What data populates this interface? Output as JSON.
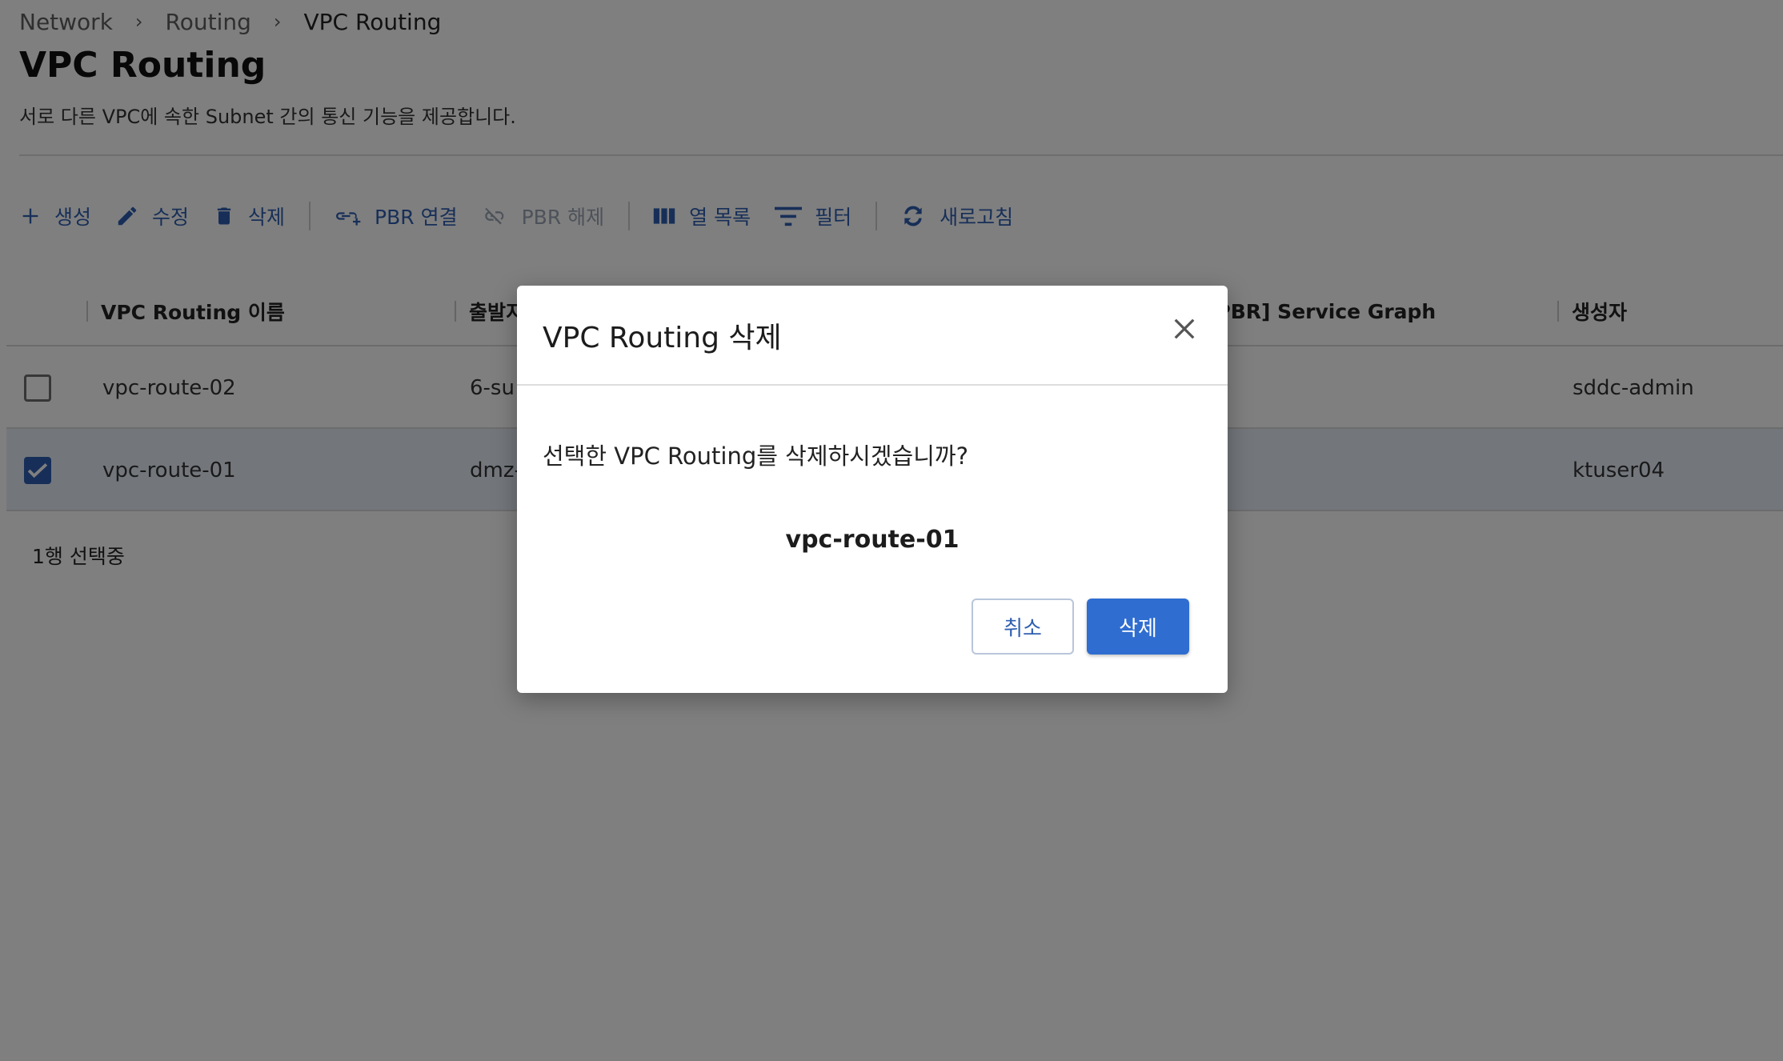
{
  "breadcrumb": [
    "Network",
    "Routing",
    "VPC Routing"
  ],
  "page": {
    "title": "VPC Routing",
    "description": "서로 다른 VPC에 속한 Subnet 간의 통신 기능을 제공합니다."
  },
  "toolbar": {
    "create": "생성",
    "edit": "수정",
    "delete": "삭제",
    "pbr_connect": "PBR 연결",
    "pbr_disconnect": "PBR 해제",
    "columns": "열 목록",
    "filter": "필터",
    "refresh": "새로고침"
  },
  "table": {
    "columns": [
      "VPC Routing 이름",
      "출발지",
      "[PBR] Service Graph",
      "생성자"
    ],
    "rows": [
      {
        "name": "vpc-route-02",
        "source": "6-su",
        "creator": "sddc-admin",
        "selected": false
      },
      {
        "name": "vpc-route-01",
        "source": "dmz-",
        "creator": "ktuser04",
        "selected": true
      }
    ],
    "selected_count": "1행 선택중"
  },
  "dialog": {
    "title": "VPC Routing 삭제",
    "message": "선택한 VPC Routing를 삭제하시겠습니까?",
    "target": "vpc-route-01",
    "cancel_label": "취소",
    "confirm_label": "삭제"
  },
  "colors": {
    "accent": "#2f5fb0",
    "primary_button": "#2f6dd0",
    "selected_row": "#e6eef9",
    "overlay": "rgba(0,0,0,0.5)"
  }
}
